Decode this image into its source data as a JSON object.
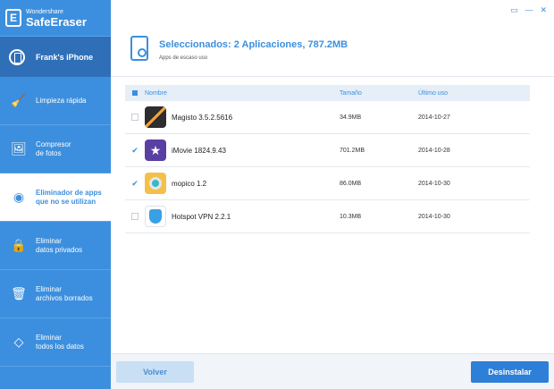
{
  "brand": {
    "small": "Wondershare",
    "big": "SafeEraser",
    "logo_letter": "E"
  },
  "device": {
    "name": "Frank's iPhone"
  },
  "nav": [
    {
      "key": "quick",
      "label_lines": [
        "Limpieza rápida"
      ],
      "icon": "broom-icon"
    },
    {
      "key": "photo",
      "label_lines": [
        "Compresor",
        "de fotos"
      ],
      "icon": "photo-icon"
    },
    {
      "key": "apps",
      "label_lines": [
        "Eliminador de apps",
        "que no se utilizan"
      ],
      "icon": "app-eraser-icon",
      "active": true
    },
    {
      "key": "private",
      "label_lines": [
        "Eliminar",
        "datos privados"
      ],
      "icon": "lock-icon"
    },
    {
      "key": "deleted",
      "label_lines": [
        "Eliminar",
        "archivos borrados"
      ],
      "icon": "trash-icon"
    },
    {
      "key": "all",
      "label_lines": [
        "Eliminar",
        "todos los datos"
      ],
      "icon": "eraser-icon"
    }
  ],
  "window": {
    "feedback": "▭",
    "minimize": "—",
    "close": "✕"
  },
  "header": {
    "title": "Seleccionados: 2 Aplicaciones, 787.2MB",
    "subtitle": "Apps de escaso uso"
  },
  "table": {
    "columns": {
      "name": "Nombre",
      "size": "Tamaño",
      "date": "Último uso"
    },
    "rows": [
      {
        "name": "Magisto 3.5.2.5616",
        "size": "34.9MB",
        "date": "2014-10-27",
        "checked": false,
        "icon": "magisto-icon"
      },
      {
        "name": "iMovie 1824.9.43",
        "size": "701.2MB",
        "date": "2014-10-28",
        "checked": true,
        "icon": "imovie-icon"
      },
      {
        "name": "mopico 1.2",
        "size": "86.0MB",
        "date": "2014-10-30",
        "checked": true,
        "icon": "mopico-icon"
      },
      {
        "name": "Hotspot VPN 2.2.1",
        "size": "10.3MB",
        "date": "2014-10-30",
        "checked": false,
        "icon": "hotspot-icon"
      }
    ]
  },
  "buttons": {
    "back": "Volver",
    "uninstall": "Desinstalar"
  },
  "colors": {
    "accent": "#3c8fde",
    "sidebar_dark": "#2f6fb8",
    "button_primary": "#2d7fd8"
  }
}
